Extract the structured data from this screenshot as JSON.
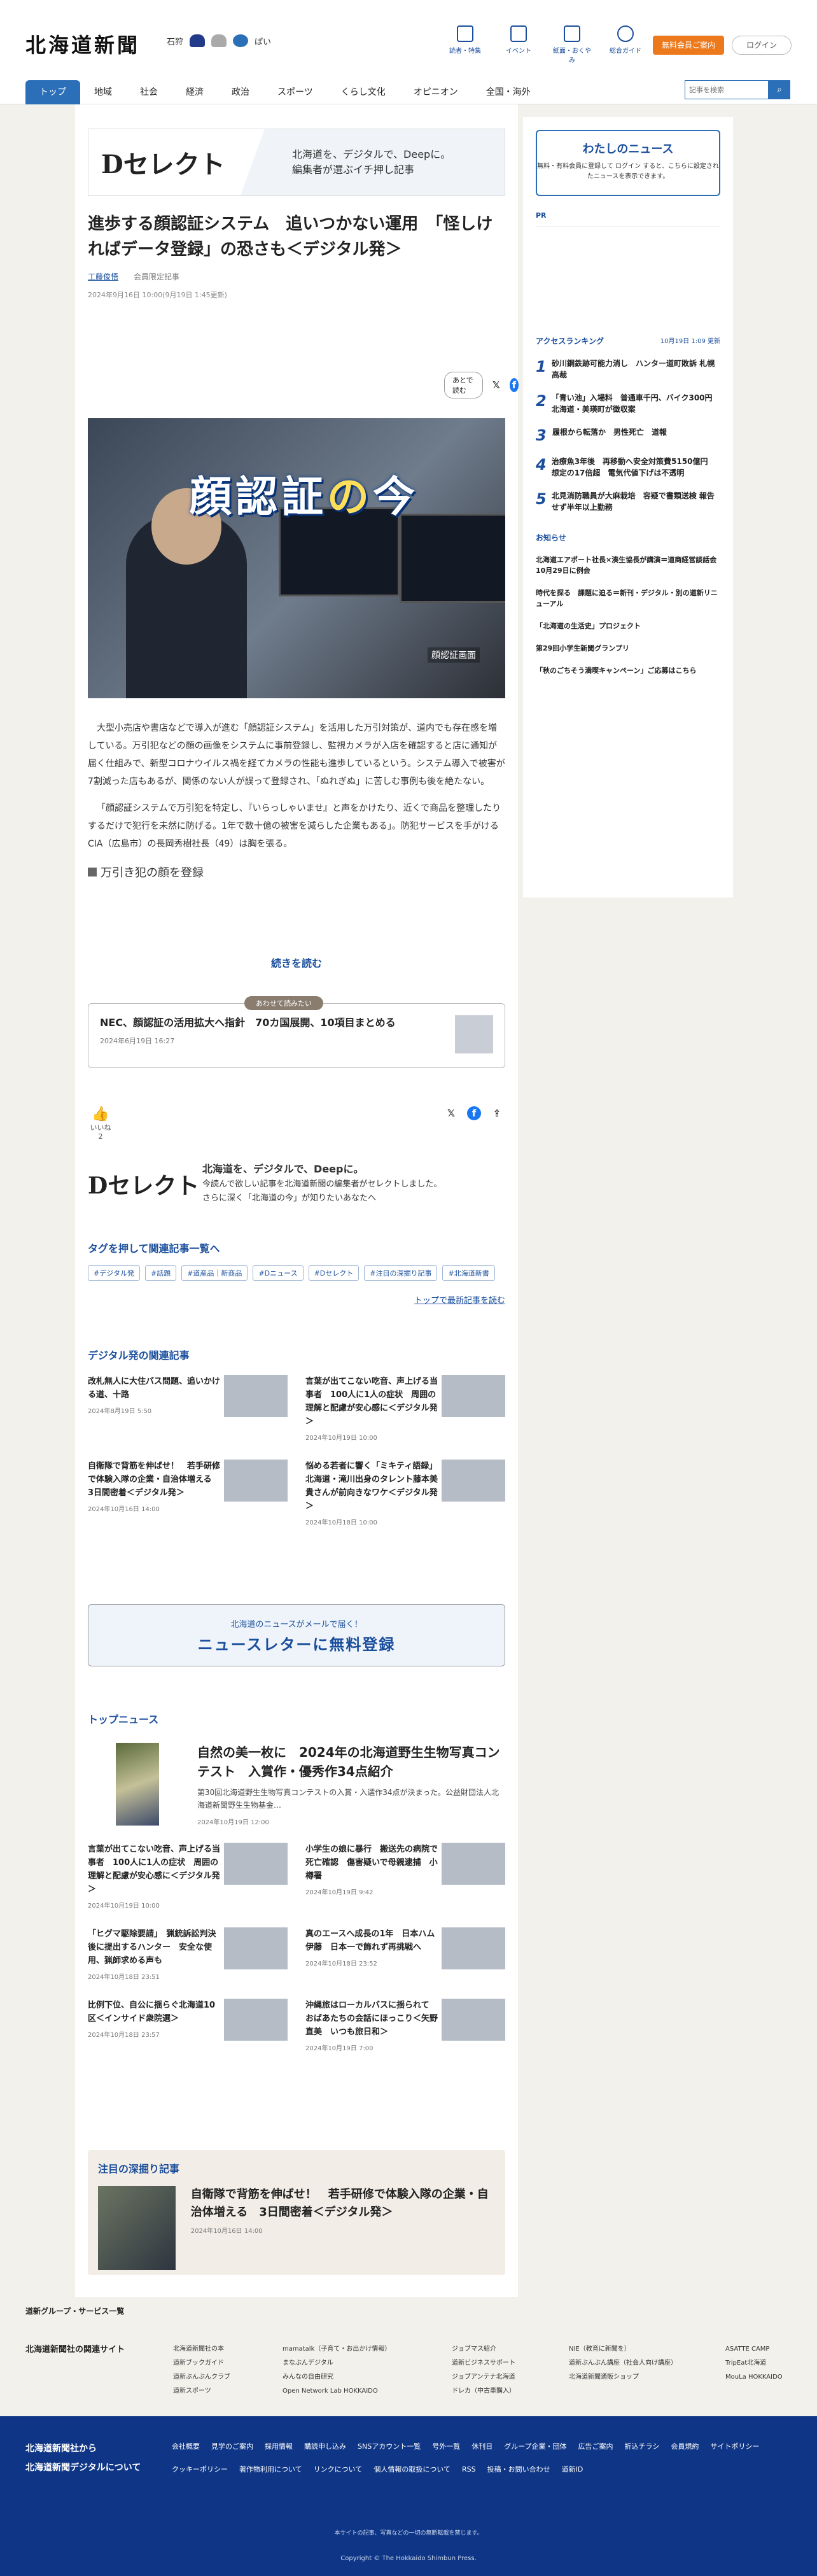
{
  "header": {
    "logo": "北海道新聞",
    "area": "石狩",
    "area2": "",
    "weather_hi": "",
    "weather_lo": "",
    "weather_label": "ぱい",
    "nav": [
      "読者・特集",
      "イベント",
      "紙面・おくやみ",
      "総合ガイド"
    ],
    "register": "無料会員ご案内",
    "login": "ログイン",
    "search_placeholder": "記事を検索"
  },
  "cats": [
    "トップ",
    "地域",
    "社会",
    "経済",
    "政治",
    "スポーツ",
    "くらし文化",
    "オピニオン",
    "全国・海外"
  ],
  "banner": {
    "logo": "Dセレクト",
    "line1": "北海道を、デジタルで、Deepに。",
    "line2": "編集者が選ぶイチ押し記事"
  },
  "article": {
    "title": "進歩する顔認証システム　追いつかない運用　「怪しければデータ登録」の恐さも＜デジタル発＞",
    "author": "工藤俊悟",
    "badge": "会員限定記事",
    "date": "2024年9月16日 10:00(9月19日 1:45更新)",
    "save": "あとで読む",
    "hero_title1": "顔認証",
    "hero_title2": "の",
    "hero_title3": "今",
    "hero_caption": "顔認証画面",
    "p1": "大型小売店や書店などで導入が進む「顔認証システム」を活用した万引対策が、道内でも存在感を増している。万引犯などの顔の画像をシステムに事前登録し、監視カメラが入店を確認すると店に通知が届く仕組みで、新型コロナウイルス禍を経てカメラの性能も進歩しているという。システム導入で被害が7割減った店もあるが、関係のない人が誤って登録され、「ぬれぎぬ」に苦しむ事例も後を絶たない。",
    "p2": "「顔認証システムで万引犯を特定し、『いらっしゃいませ』と声をかけたり、近くで商品を整理したりするだけで犯行を未然に防げる。1年で数十億の被害を減らした企業もある」。防犯サービスを手がけるCIA（広島市）の長岡秀樹社長（49）は胸を張る。",
    "sub": "万引き犯の顔を登録",
    "more": "続きを読む"
  },
  "related": {
    "tab": "あわせて読みたい",
    "title": "NEC、顔認証の活用拡大へ指針　70カ国展開、10項目まとめる",
    "date": "2024年6月19日 16:27"
  },
  "like": {
    "label": "いいね",
    "count": "2"
  },
  "dsel2": {
    "logo": "Dセレクト",
    "l1": "北海道を、デジタルで、Deepに。",
    "l2": "今読んで欲しい記事を北海道新聞の編集者がセレクトしました。",
    "l3": "さらに深く「北海道の今」が知りたいあなたへ"
  },
  "tags": {
    "head": "タグを押して関連記事一覧へ",
    "items": [
      "#デジタル発",
      "#話題",
      "#道産品｜新商品",
      "#Dニュース",
      "#Dセレクト",
      "#注目の深掘り記事",
      "#北海道新書"
    ],
    "more": "トップで最新記事を読む"
  },
  "digital": {
    "head": "デジタル発の関連記事",
    "items": [
      {
        "t": "改札無人に大住バス問題、追いかける道、十路",
        "d": "2024年8月19日 5:50"
      },
      {
        "t": "言葉が出てこない吃音、声上げる当事者　100人に1人の症状　周囲の理解と配慮が安心感に＜デジタル発＞",
        "d": "2024年10月19日 10:00"
      },
      {
        "t": "自衛隊で背筋を伸ばせ！　若手研修で体験入隊の企業・自治体増える　3日間密着＜デジタル発＞",
        "d": "2024年10月16日 14:00"
      },
      {
        "t": "悩める若者に響く「ミキティ語録」　北海道・滝川出身のタレント藤本美貴さんが前向きなワケ＜デジタル発＞",
        "d": "2024年10月18日 10:00"
      }
    ]
  },
  "newsletter": {
    "s": "北海道のニュースがメールで届く！",
    "b": "ニュースレターに無料登録"
  },
  "top": {
    "head": "トップニュース",
    "lead": {
      "t": "自然の美一枚に　2024年の北海道野生生物写真コンテスト　入賞作・優秀作34点紹介",
      "s": "第30回北海道野生生物写真コンテストの入賞・入選作34点が決まった。公益財団法人北海道新聞野生生物基金…",
      "d": "2024年10月19日 12:00"
    },
    "items": [
      {
        "t": "言葉が出てこない吃音、声上げる当事者　100人に1人の症状　周囲の理解と配慮が安心感に＜デジタル発＞",
        "d": "2024年10月19日 10:00"
      },
      {
        "t": "小学生の娘に暴行　搬送先の病院で死亡確認　傷害疑いで母親逮捕　小樽署",
        "d": "2024年10月19日 9:42"
      },
      {
        "t": "「ヒグマ駆除要請」　猟銃訴訟判決後に提出するハンター　安全な使用、猟師求める声も",
        "d": "2024年10月18日 23:51"
      },
      {
        "t": "真のエースへ成長の1年　日本ハム伊藤　日本一で飾れず再挑戦へ",
        "d": "2024年10月18日 23:52"
      },
      {
        "t": "比例下位、自公に揺らぐ北海道10区＜インサイド衆院選＞",
        "d": "2024年10月18日 23:57"
      },
      {
        "t": "沖縄旅はローカルバスに揺られて　おばあたちの会話にほっこり＜矢野直美　いつも旅日和＞",
        "d": "2024年10月19日 7:00"
      }
    ]
  },
  "feature": {
    "head": "注目の深掘り記事",
    "t": "自衛隊で背筋を伸ばせ！　若手研修で体験入隊の企業・自治体増える　3日間密着＜デジタル発＞",
    "d": "2024年10月16日 14:00"
  },
  "side": {
    "my_t": "わたしのニュース",
    "my_s": "無料・有料会員に登録して ログイン すると、こちらに設定されたニュースを表示できます。",
    "pr": "PR",
    "rank_h": "アクセスランキング",
    "rank_d": "10月19日 1:09 更新",
    "ranks": [
      "砂川鋼鉄跡可能力消し　ハンター道町敗訴 札幌高裁",
      "「青い池」入場料　普通車千円、バイク300円　北海道・美瑛町が徴収案",
      "履根から転落か　男性死亡　道報",
      "治療魚3年後　再移動へ安全対策費5150億円　想定の17倍超　電気代値下げは不透明",
      "北見消防職員が大麻栽培　容疑で書類送検 報告せず半年以上勤務"
    ],
    "os_h": "お知らせ",
    "os": [
      "北海道エアポート社長×湊生協長が講演＝道商経営談話会10月29日に例会",
      "時代を探る　課題に迫る＝新刊・デジタル・別の道新リニューアル",
      "「北海道の生活史」プロジェクト",
      "第29回小学生新聞グランプリ",
      "「秋のごちそう満喫キャンペーン」ご応募はこちら"
    ]
  },
  "group": {
    "h": "道新グループ・サービス一覧",
    "st": "北海道新聞社の関連サイト",
    "cols": [
      [
        "北海道新聞社の本",
        "道新ブックガイド",
        "道新ぶんぶんクラブ",
        "道新スポーツ"
      ],
      [
        "mamatalk（子育て・お出かけ情報）",
        "まなぶんデジタル",
        "みんなの自由研究",
        "Open Network Lab HOKKAIDO"
      ],
      [
        "ジョブマス紹介",
        "道新ビジネスサポート",
        "ジョブアンテナ北海道",
        "ドレカ（中古車購入）"
      ],
      [
        "NIE（教育に新聞を）",
        "道新ぶんぶん講座（社会人向け講座）",
        "北海道新聞通販ショップ"
      ],
      [
        "ASATTE CAMP",
        "TripEat北海道",
        "MouLa HOKKAIDO"
      ]
    ]
  },
  "footer": {
    "l1": "北海道新聞社から",
    "l2": "北海道新聞デジタルについて",
    "links": [
      "会社概要",
      "見学のご案内",
      "採用情報",
      "購読申し込み",
      "SNSアカウント一覧",
      "号外一覧",
      "休刊日",
      "グループ企業・団体",
      "広告ご案内",
      "折込チラシ",
      "会員規約",
      "サイトポリシー",
      "クッキーポリシー",
      "著作物利用について",
      "リンクについて",
      "個人情報の取扱について",
      "RSS",
      "投稿・お問い合わせ",
      "道新ID"
    ],
    "note": "本サイトの記事、写真などの一切の無断転載を禁じます。",
    "cp": "Copyright © The Hokkaido Shimbun Press."
  }
}
